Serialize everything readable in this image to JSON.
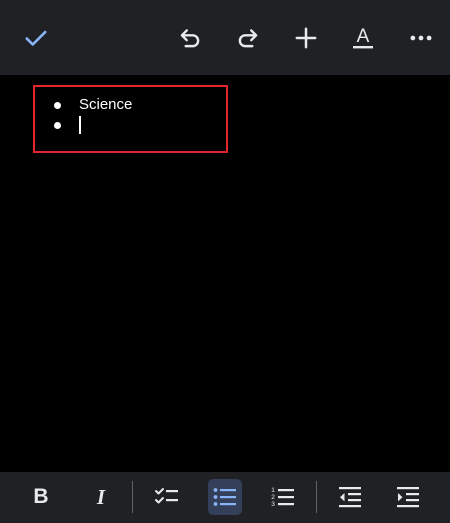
{
  "colors": {
    "toolbar_bg": "#202124",
    "canvas_bg": "#000000",
    "accent_blue": "#8ab4f8",
    "icon_gray": "#e8eaed",
    "highlight_red": "#e3262b",
    "active_bg": "#34405a"
  },
  "top_toolbar": {
    "icons": [
      "check-icon",
      "undo-icon",
      "redo-icon",
      "plus-icon",
      "text-format-icon",
      "more-icon"
    ],
    "text_format_glyph": "A"
  },
  "document": {
    "list_type": "bulleted",
    "items": [
      "Science",
      ""
    ]
  },
  "bottom_toolbar": {
    "bold_glyph": "B",
    "italic_glyph": "I",
    "icons": [
      "checklist-icon",
      "bulleted-list-icon",
      "numbered-list-icon",
      "outdent-icon",
      "indent-icon"
    ],
    "active": "bulleted-list",
    "numbered_digits": [
      "1",
      "2",
      "3"
    ]
  }
}
